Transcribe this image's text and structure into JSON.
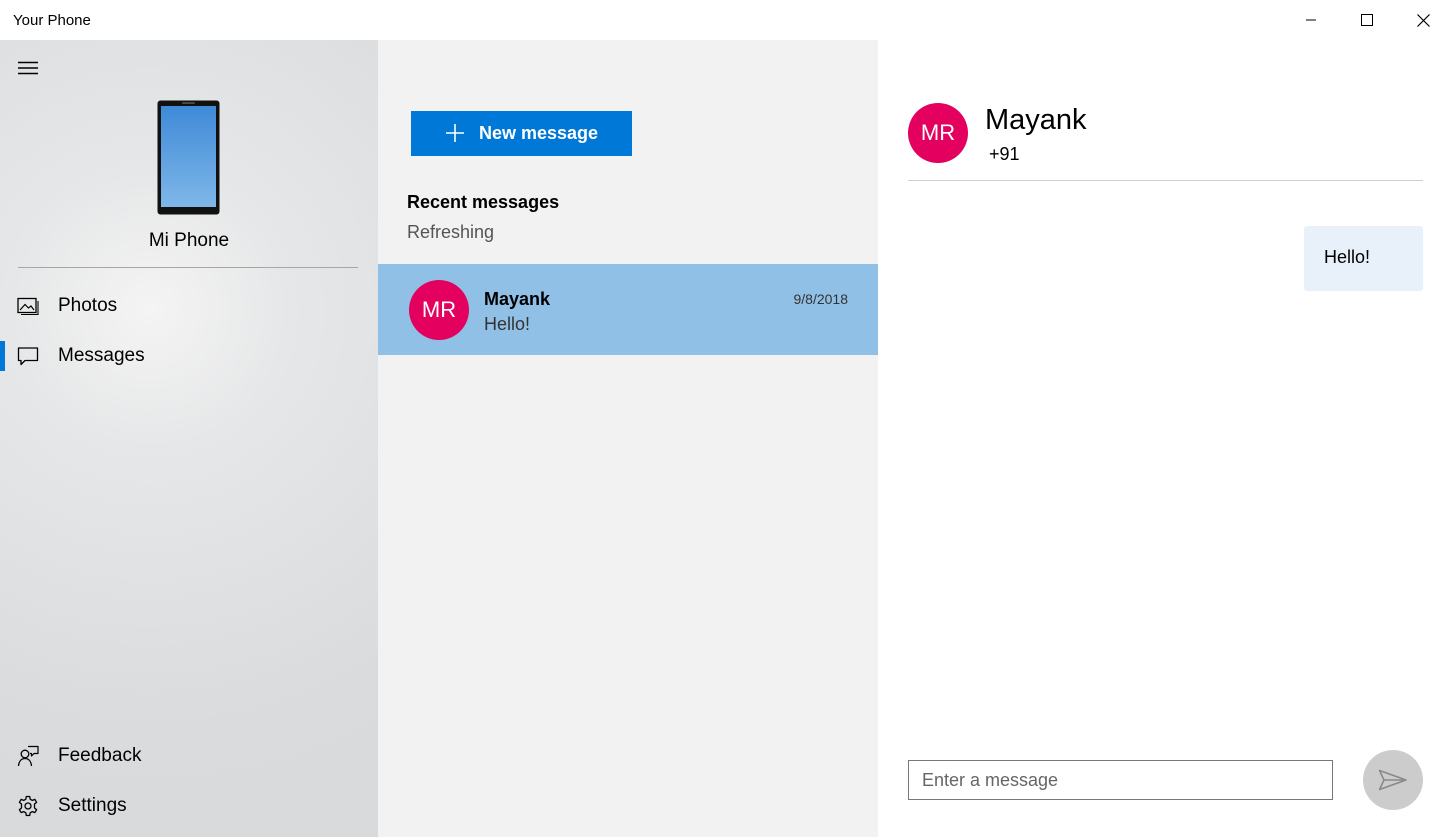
{
  "window": {
    "title": "Your Phone",
    "controls": {
      "minimize": "minimize-icon",
      "maximize": "maximize-icon",
      "close": "close-icon"
    }
  },
  "nav": {
    "menu_icon": "hamburger-icon",
    "device_name": "Mi Phone",
    "items": [
      {
        "label": "Photos",
        "icon": "photos-icon",
        "selected": false
      },
      {
        "label": "Messages",
        "icon": "message-icon",
        "selected": true
      }
    ],
    "footer_items": [
      {
        "label": "Feedback",
        "icon": "feedback-icon"
      },
      {
        "label": "Settings",
        "icon": "gear-icon"
      }
    ],
    "accent_color": "#0078d7"
  },
  "list": {
    "new_message_label": "New message",
    "section_title": "Recent messages",
    "status": "Refreshing",
    "conversations": [
      {
        "initials": "MR",
        "name": "Mayank",
        "preview": "Hello!",
        "date": "9/8/2018",
        "selected": true
      }
    ]
  },
  "chat": {
    "contact": {
      "initials": "MR",
      "name": "Mayank",
      "number": "+91"
    },
    "messages": [
      {
        "text": "Hello!",
        "direction": "sent"
      }
    ],
    "input_placeholder": "Enter a message",
    "send_icon": "send-icon"
  },
  "colors": {
    "avatar": "#e3005e",
    "selected_row": "#91c0e7",
    "button": "#0078d7"
  }
}
